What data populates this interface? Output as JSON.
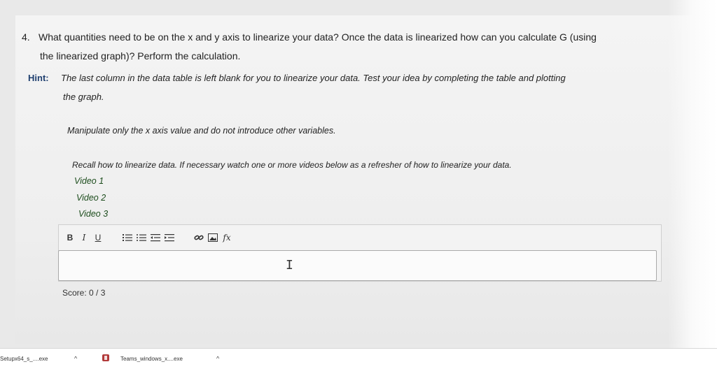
{
  "question": {
    "number": "4.",
    "line1": "What quantities need to be on the x and y axis to linearize your data? Once the data is linearized how can you calculate G (using",
    "line2": "the linearized graph)? Perform the calculation."
  },
  "hint": {
    "label": "Hint:",
    "line1": "The last column in the data table is left blank for you to linearize your data. Test your idea by completing the table and plotting",
    "line2": "the graph."
  },
  "instruction": "Manipulate only the x axis value and do not introduce other variables.",
  "recall": "Recall how to linearize data. If necessary  watch one or more videos below as a refresher of how to linearize your data.",
  "videos": [
    "Video 1",
    "Video 2",
    "Video 3"
  ],
  "toolbar": {
    "bold": "B",
    "italic": "I",
    "underline": "U",
    "formula": "fx"
  },
  "score": "Score:  0 / 3",
  "taskbar": {
    "download1": "Setupx64_s_....exe",
    "download2": "Teams_windows_x....exe",
    "chevron": "^"
  }
}
